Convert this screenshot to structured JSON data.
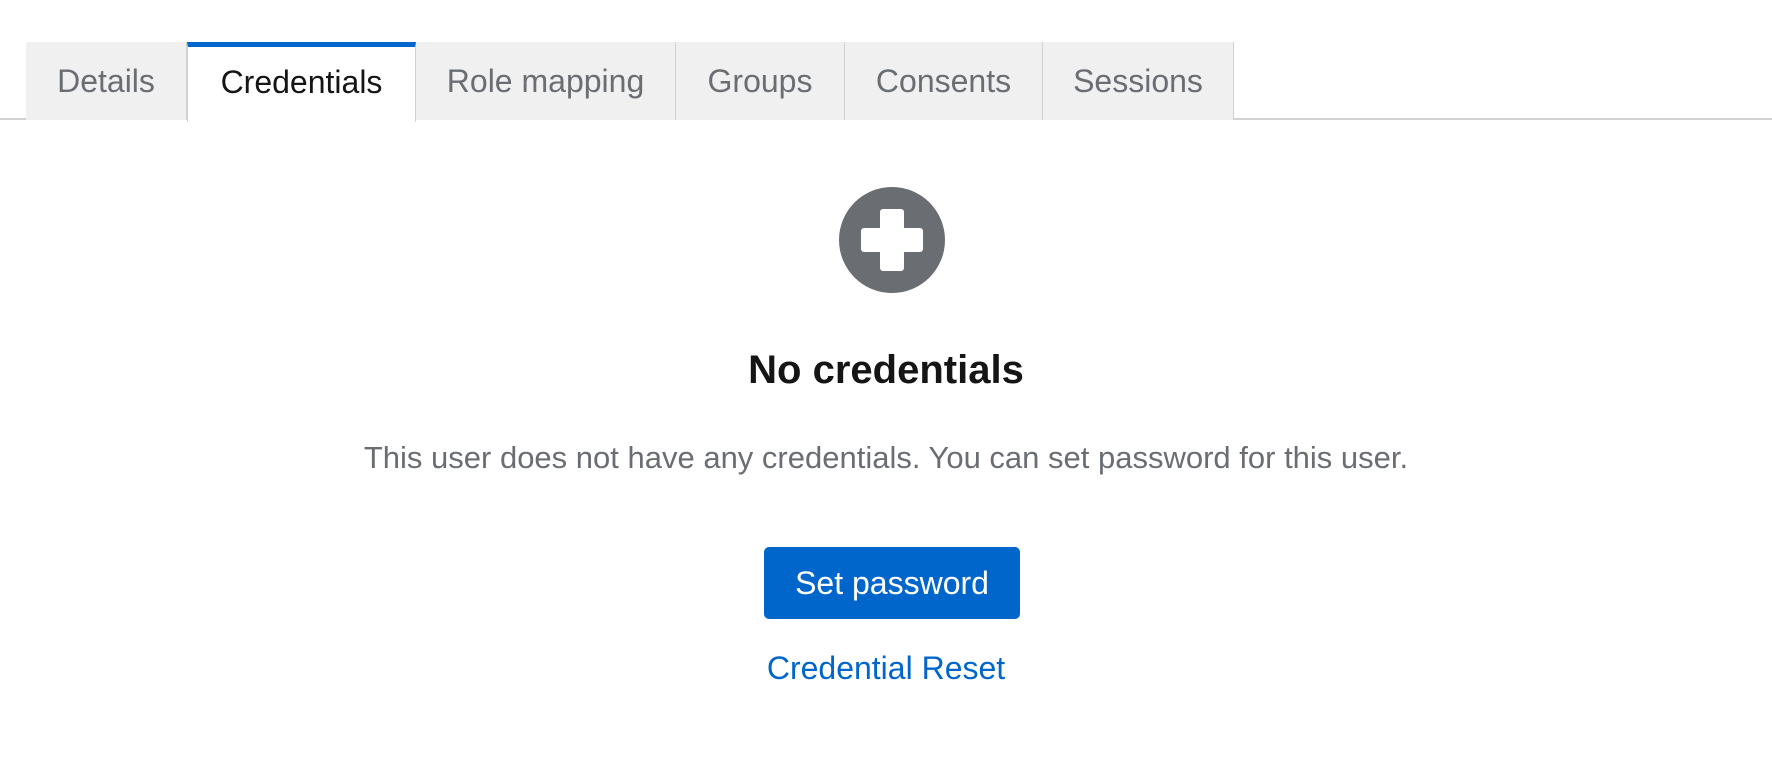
{
  "tabs": [
    {
      "label": "Details",
      "active": false
    },
    {
      "label": "Credentials",
      "active": true
    },
    {
      "label": "Role mapping",
      "active": false
    },
    {
      "label": "Groups",
      "active": false
    },
    {
      "label": "Consents",
      "active": false
    },
    {
      "label": "Sessions",
      "active": false
    }
  ],
  "empty_state": {
    "icon": "plus-circle-icon",
    "title": "No credentials",
    "body": "This user does not have any credentials. You can set password for this user.",
    "primary_action": "Set password",
    "secondary_action": "Credential Reset"
  },
  "colors": {
    "accent": "#0066cc",
    "icon": "#6a6e73",
    "tab_background": "#f0f0f0",
    "title_text": "#151515",
    "muted_text": "#6a6e73"
  }
}
